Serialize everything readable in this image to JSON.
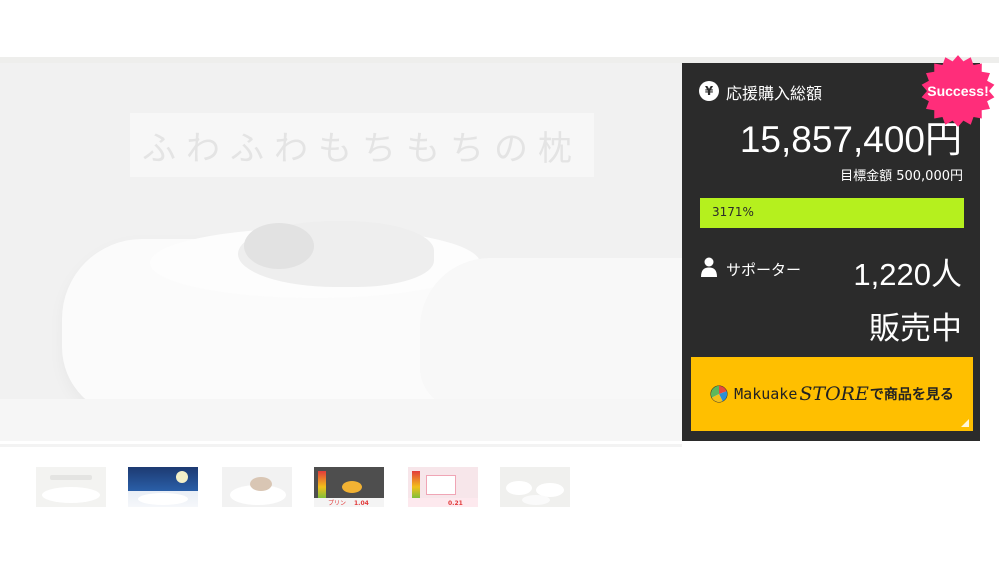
{
  "hero": {
    "title": "ふわふわもちもちの枕",
    "image_alt": "pillow-sleeping-photo"
  },
  "funding": {
    "currency_symbol": "¥",
    "total_label": "応援購入総額",
    "total_amount": "15,857,400円",
    "goal_text": "目標金額 500,000円",
    "progress_text": "3171%",
    "progress_fraction": 1.0
  },
  "supporters": {
    "label": "サポーター",
    "count": "1,220人"
  },
  "status": {
    "sale_text": "販売中",
    "badge": "Success!"
  },
  "store_button": {
    "brand": "Makuake",
    "store_word": "STORE",
    "rest": "で商品を見る"
  },
  "thumbnails": {
    "t4_caption": "プリン",
    "t4_value": "1.04",
    "t5_value": "0.21"
  },
  "colors": {
    "sidebar_bg": "#2b2b2b",
    "progress_green": "#b5f01e",
    "store_yellow": "#ffbf00",
    "badge_pink": "#ff2d7a"
  }
}
